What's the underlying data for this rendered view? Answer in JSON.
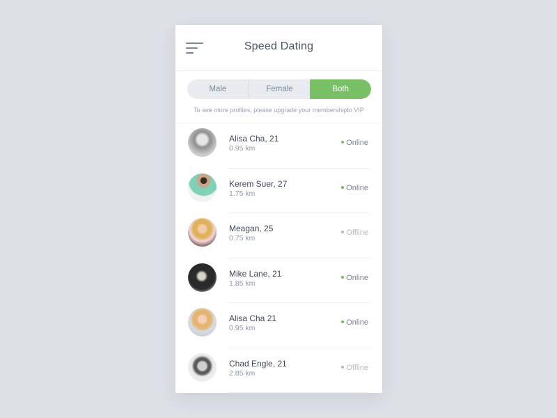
{
  "header": {
    "title": "Speed Dating",
    "menu_icon": "hamburger-menu-icon"
  },
  "filter": {
    "options": [
      "Male",
      "Female",
      "Both"
    ],
    "selected": "Both",
    "accent_color": "#77c064"
  },
  "notice": "To see more profiles, please upgrade your membershipto VIP",
  "profiles": [
    {
      "name": "Alisa Cha, 21",
      "distance": "0.95 km",
      "status": "Online"
    },
    {
      "name": "Kerem Suer, 27",
      "distance": "1.75 km",
      "status": "Online"
    },
    {
      "name": "Meagan, 25",
      "distance": "0.75 km",
      "status": "Offline"
    },
    {
      "name": "Mike Lane, 21",
      "distance": "1.85 km",
      "status": "Online"
    },
    {
      "name": "Alisa Cha 21",
      "distance": "0.95 km",
      "status": "Online"
    },
    {
      "name": "Chad Engle, 21",
      "distance": "2.85 km",
      "status": "Offline"
    }
  ],
  "status_colors": {
    "online": "#6cc05a",
    "offline": "#b4bac4"
  }
}
